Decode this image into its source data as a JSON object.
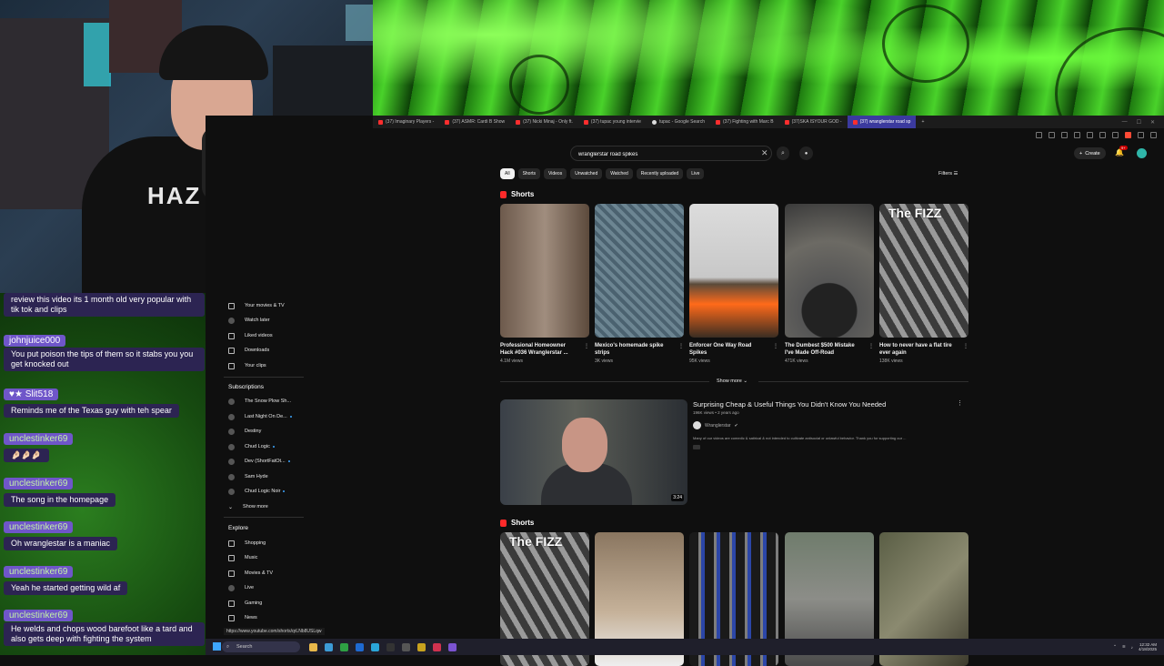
{
  "tabs": [
    {
      "label": "(37) Imaginary Players -",
      "active": false
    },
    {
      "label": "(37) ASMR: Cardi B Show",
      "active": false
    },
    {
      "label": "(37) Nicki Minaj - Only ft.",
      "active": false
    },
    {
      "label": "(37) tupac young intervie",
      "active": false
    },
    {
      "label": "tupac - Google Search",
      "active": false
    },
    {
      "label": "(37) Fighting with Marc B",
      "active": false
    },
    {
      "label": "(37)SKA ISYOUR GOD -",
      "active": false
    },
    {
      "label": "(37) wranglerstar road sp",
      "active": true
    }
  ],
  "search": {
    "value": "wranglerstar road spikes"
  },
  "header": {
    "create_label": "Create",
    "bell_badge": "9+"
  },
  "chips": [
    "All",
    "Shorts",
    "Videos",
    "Unwatched",
    "Watched",
    "Recently uploaded",
    "Live"
  ],
  "filters_label": "Filters",
  "sidebar": {
    "you_items": [
      "Your movies & TV",
      "Watch later",
      "Liked videos",
      "Downloads",
      "Your clips"
    ],
    "subscriptions_title": "Subscriptions",
    "subscriptions": [
      "The Snow Plow Sh...",
      "Last Night On De...",
      "Destiny",
      "Chud Logic",
      "Dev (ShortFatOt...",
      "Sam Hyde",
      "Chud Logic Noir"
    ],
    "show_more_label": "Show more",
    "explore_title": "Explore",
    "explore_items": [
      "Shopping",
      "Music",
      "Movies & TV",
      "Live",
      "Gaming",
      "News"
    ]
  },
  "shorts_section_title": "Shorts",
  "shorts": [
    {
      "title": "Professional Homeowner Hack #036 Wranglerstar ...",
      "views": "4.1M views"
    },
    {
      "title": "Mexico's homemade spike strips",
      "views": "3K views"
    },
    {
      "title": "Enforcer One Way Road Spikes",
      "views": "95K views"
    },
    {
      "title": "The Dumbest $500 Mistake I've Made Off-Road",
      "views": "471K views"
    },
    {
      "title": "How to never have a flat tire ever again",
      "views": "138K views",
      "overlay": "The FIZZ"
    }
  ],
  "shorts2_overlay": "The FIZZ",
  "show_more_shorts": "Show more",
  "video": {
    "title": "Surprising Cheap & Useful Things You Didn't Know You Needed",
    "meta": "196K views • 2 years ago",
    "channel": "Wranglerstar",
    "description": "Many of our videos are comedic & satirical & not intended to cultivate antisocial or unlawful behavior. Thank you for supporting our ...",
    "duration": "3:24"
  },
  "shorts2_section_title": "Shorts",
  "status_url": "https://www.youtube.com/shorts/qrLNb8USLqw",
  "chat": [
    {
      "user": "",
      "text": "review this video its 1 month old very popular with tik tok and clips"
    },
    {
      "user": "johnjuice000",
      "text": "You put poison the tips of them so it stabs you you get knocked out"
    },
    {
      "user": "Slit518",
      "text": "Reminds me of the Texas guy with teh spear"
    },
    {
      "user": "unclestinker69",
      "text": "🤌🏻🤌🏻🤌🏻"
    },
    {
      "user": "unclestinker69",
      "text": "The song in the homepage"
    },
    {
      "user": "unclestinker69",
      "text": "Oh wranglestar is a maniac"
    },
    {
      "user": "unclestinker69",
      "text": "Yeah he started getting wild af"
    },
    {
      "user": "unclestinker69",
      "text": "He welds and chops wood barefoot like a tard and also gets deep with fighting the system"
    }
  ],
  "webcam": {
    "shirt_text": "HAZ ART"
  },
  "taskbar": {
    "search_placeholder": "Search",
    "time": "12:32 AM",
    "date": "4/18/2025"
  }
}
